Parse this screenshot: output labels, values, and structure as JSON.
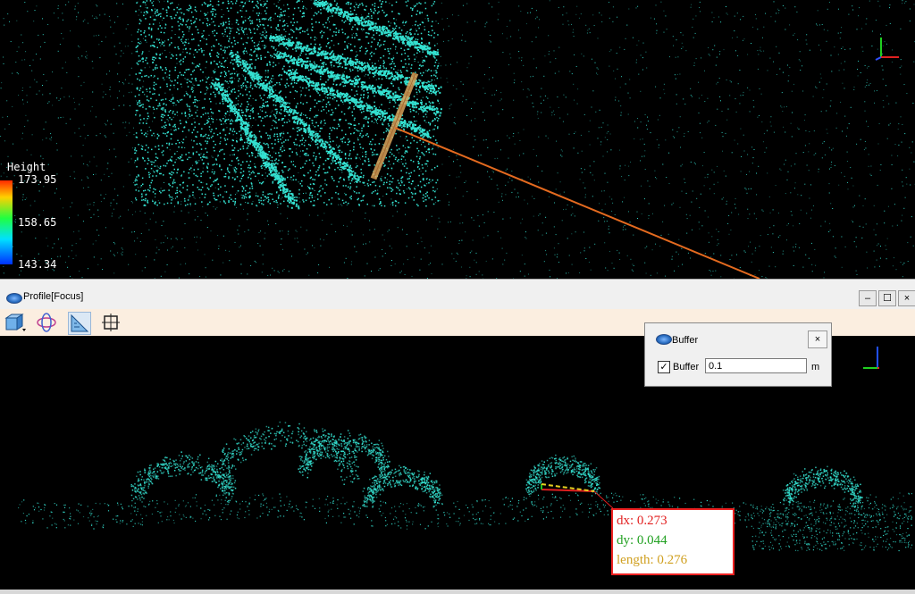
{
  "top_view": {
    "legend": {
      "title": "Height",
      "max": "173.95",
      "mid": "158.65",
      "min": "143.34"
    },
    "colors": {
      "points": "#34e0d0",
      "section_line": "#e46a1f"
    }
  },
  "profile_window": {
    "title": "Profile[Focus]",
    "controls": {
      "minimize": "–",
      "maximize": "☐",
      "close": "×"
    },
    "toolbar": [
      "cube-view-icon",
      "orbit-icon",
      "measure-ruler-icon",
      "grid-crop-icon"
    ]
  },
  "buffer_dialog": {
    "title": "Buffer",
    "checkbox_label": "Buffer",
    "checked": true,
    "value": "0.1",
    "unit": "m",
    "close": "×"
  },
  "measurement": {
    "dx_label": "dx:",
    "dx_value": "0.273",
    "dy_label": "dy:",
    "dy_value": "0.044",
    "length_label": "length:",
    "length_value": "0.276",
    "colors": {
      "dx": "#e22020",
      "dy": "#20a020",
      "length": "#d0a020"
    }
  },
  "axis_labels": {
    "x": "x",
    "y": "y",
    "z": "z"
  }
}
